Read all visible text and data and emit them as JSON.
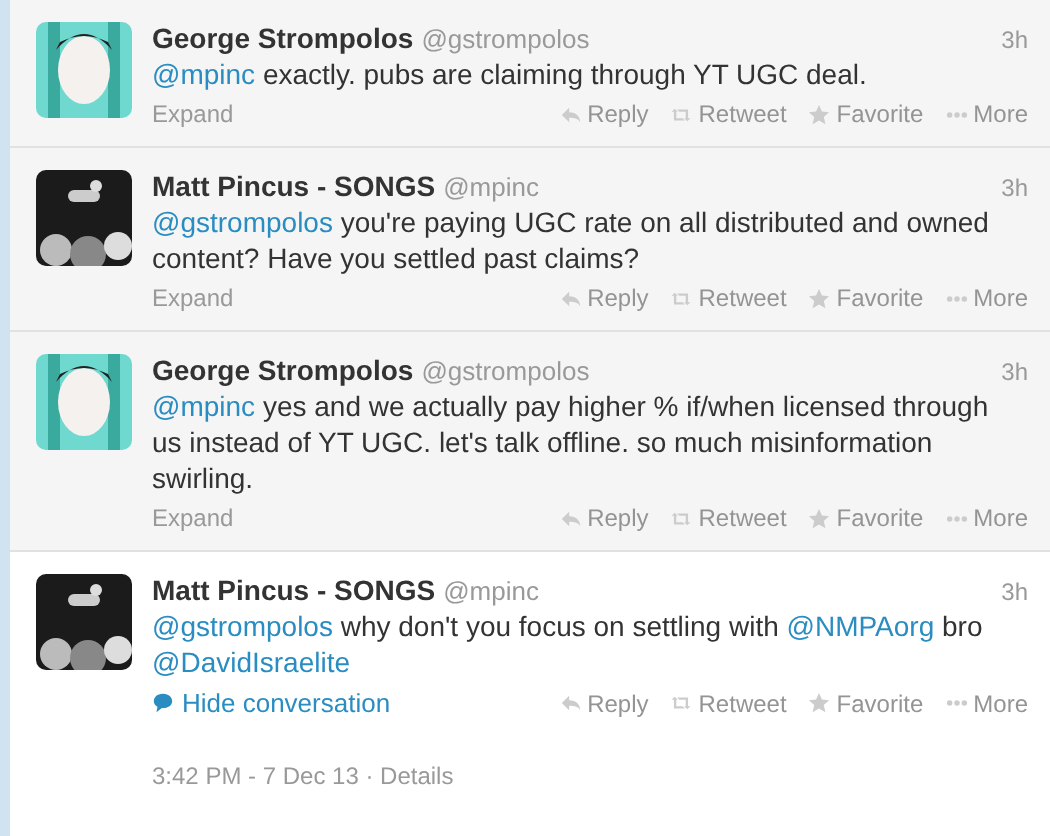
{
  "tweets": [
    {
      "name": "George Strompolos",
      "handle": "@gstrompolos",
      "time": "3h",
      "expanded": false,
      "text": [
        {
          "kind": "mention",
          "text": "@mpinc"
        },
        {
          "kind": "plain",
          "text": " exactly. pubs are claiming through YT UGC deal."
        }
      ],
      "footer": {
        "kind": "expand",
        "text": "Expand"
      },
      "actions": [
        {
          "kind": "reply",
          "label": "Reply"
        },
        {
          "kind": "retweet",
          "label": "Retweet"
        },
        {
          "kind": "favorite",
          "label": "Favorite"
        },
        {
          "kind": "more",
          "label": "More"
        }
      ]
    },
    {
      "name": "Matt Pincus - SONGS",
      "handle": "@mpinc",
      "time": "3h",
      "expanded": false,
      "text": [
        {
          "kind": "mention",
          "text": "@gstrompolos"
        },
        {
          "kind": "plain",
          "text": " you're paying UGC rate on all distributed and owned content? Have you settled past claims?"
        }
      ],
      "footer": {
        "kind": "expand",
        "text": "Expand"
      },
      "actions": [
        {
          "kind": "reply",
          "label": "Reply"
        },
        {
          "kind": "retweet",
          "label": "Retweet"
        },
        {
          "kind": "favorite",
          "label": "Favorite"
        },
        {
          "kind": "more",
          "label": "More"
        }
      ]
    },
    {
      "name": "George Strompolos",
      "handle": "@gstrompolos",
      "time": "3h",
      "expanded": false,
      "text": [
        {
          "kind": "mention",
          "text": "@mpinc"
        },
        {
          "kind": "plain",
          "text": " yes and we actually pay higher % if/when licensed through us instead of YT UGC. let's talk offline. so much misinformation swirling."
        }
      ],
      "footer": {
        "kind": "expand",
        "text": "Expand"
      },
      "actions": [
        {
          "kind": "reply",
          "label": "Reply"
        },
        {
          "kind": "retweet",
          "label": "Retweet"
        },
        {
          "kind": "favorite",
          "label": "Favorite"
        },
        {
          "kind": "more",
          "label": "More"
        }
      ]
    },
    {
      "name": "Matt Pincus - SONGS",
      "handle": "@mpinc",
      "time": "3h",
      "expanded": true,
      "text": [
        {
          "kind": "mention",
          "text": "@gstrompolos"
        },
        {
          "kind": "plain",
          "text": " why don't you focus on settling with "
        },
        {
          "kind": "mention",
          "text": "@NMPAorg"
        },
        {
          "kind": "plain",
          "text": " bro "
        },
        {
          "kind": "mention",
          "text": "@DavidIsraelite"
        }
      ],
      "footer": {
        "kind": "conversation",
        "text": "Hide conversation"
      },
      "timestamp": "3:42 PM - 7 Dec 13 · Details",
      "actions": [
        {
          "kind": "reply",
          "label": "Reply"
        },
        {
          "kind": "retweet",
          "label": "Retweet"
        },
        {
          "kind": "favorite",
          "label": "Favorite"
        },
        {
          "kind": "more",
          "label": "More"
        }
      ]
    }
  ]
}
